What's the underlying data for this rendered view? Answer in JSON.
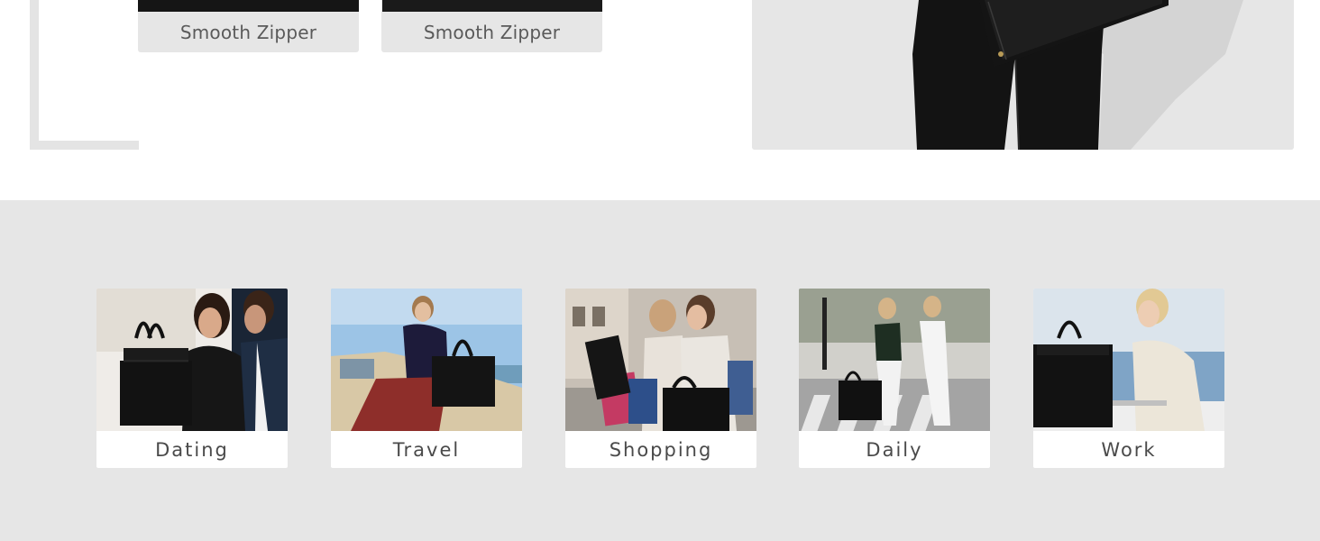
{
  "feature_cards": [
    {
      "label": "Smooth Zipper"
    },
    {
      "label": "Smooth Zipper"
    }
  ],
  "scenes": [
    {
      "label": "Dating"
    },
    {
      "label": "Travel"
    },
    {
      "label": "Shopping"
    },
    {
      "label": "Daily"
    },
    {
      "label": "Work"
    }
  ],
  "colors": {
    "page_background": "#ffffff",
    "section_background": "#e6e6e6",
    "caption_text": "#5a5a5a",
    "bag_black": "#111111"
  }
}
